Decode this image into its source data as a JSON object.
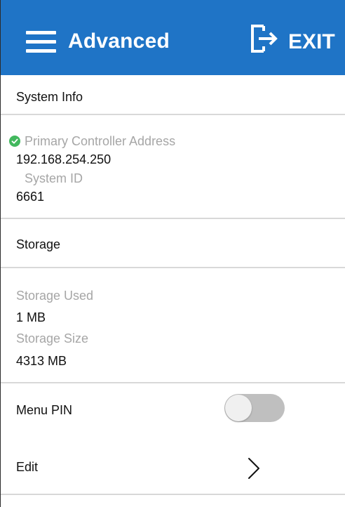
{
  "header": {
    "title": "Advanced",
    "exit_label": "EXIT",
    "background": "#1f74c6",
    "menu_icon": "hamburger-menu-icon",
    "exit_icon": "exit-door-arrow-icon"
  },
  "system_info": {
    "section_label": "System Info",
    "status_color": "#42b85e",
    "primary_controller_address_label": "Primary Controller Address",
    "primary_controller_address": "192.168.254.250",
    "system_id_label": "System ID",
    "system_id": "6661"
  },
  "storage": {
    "section_label": "Storage",
    "storage_used_label": "Storage Used",
    "storage_used": "1 MB",
    "storage_size_label": "Storage Size",
    "storage_size": "4313 MB"
  },
  "menu_pin": {
    "label": "Menu PIN",
    "toggle_on": false
  },
  "edit": {
    "label": "Edit",
    "icon": "chevron-right-icon"
  }
}
